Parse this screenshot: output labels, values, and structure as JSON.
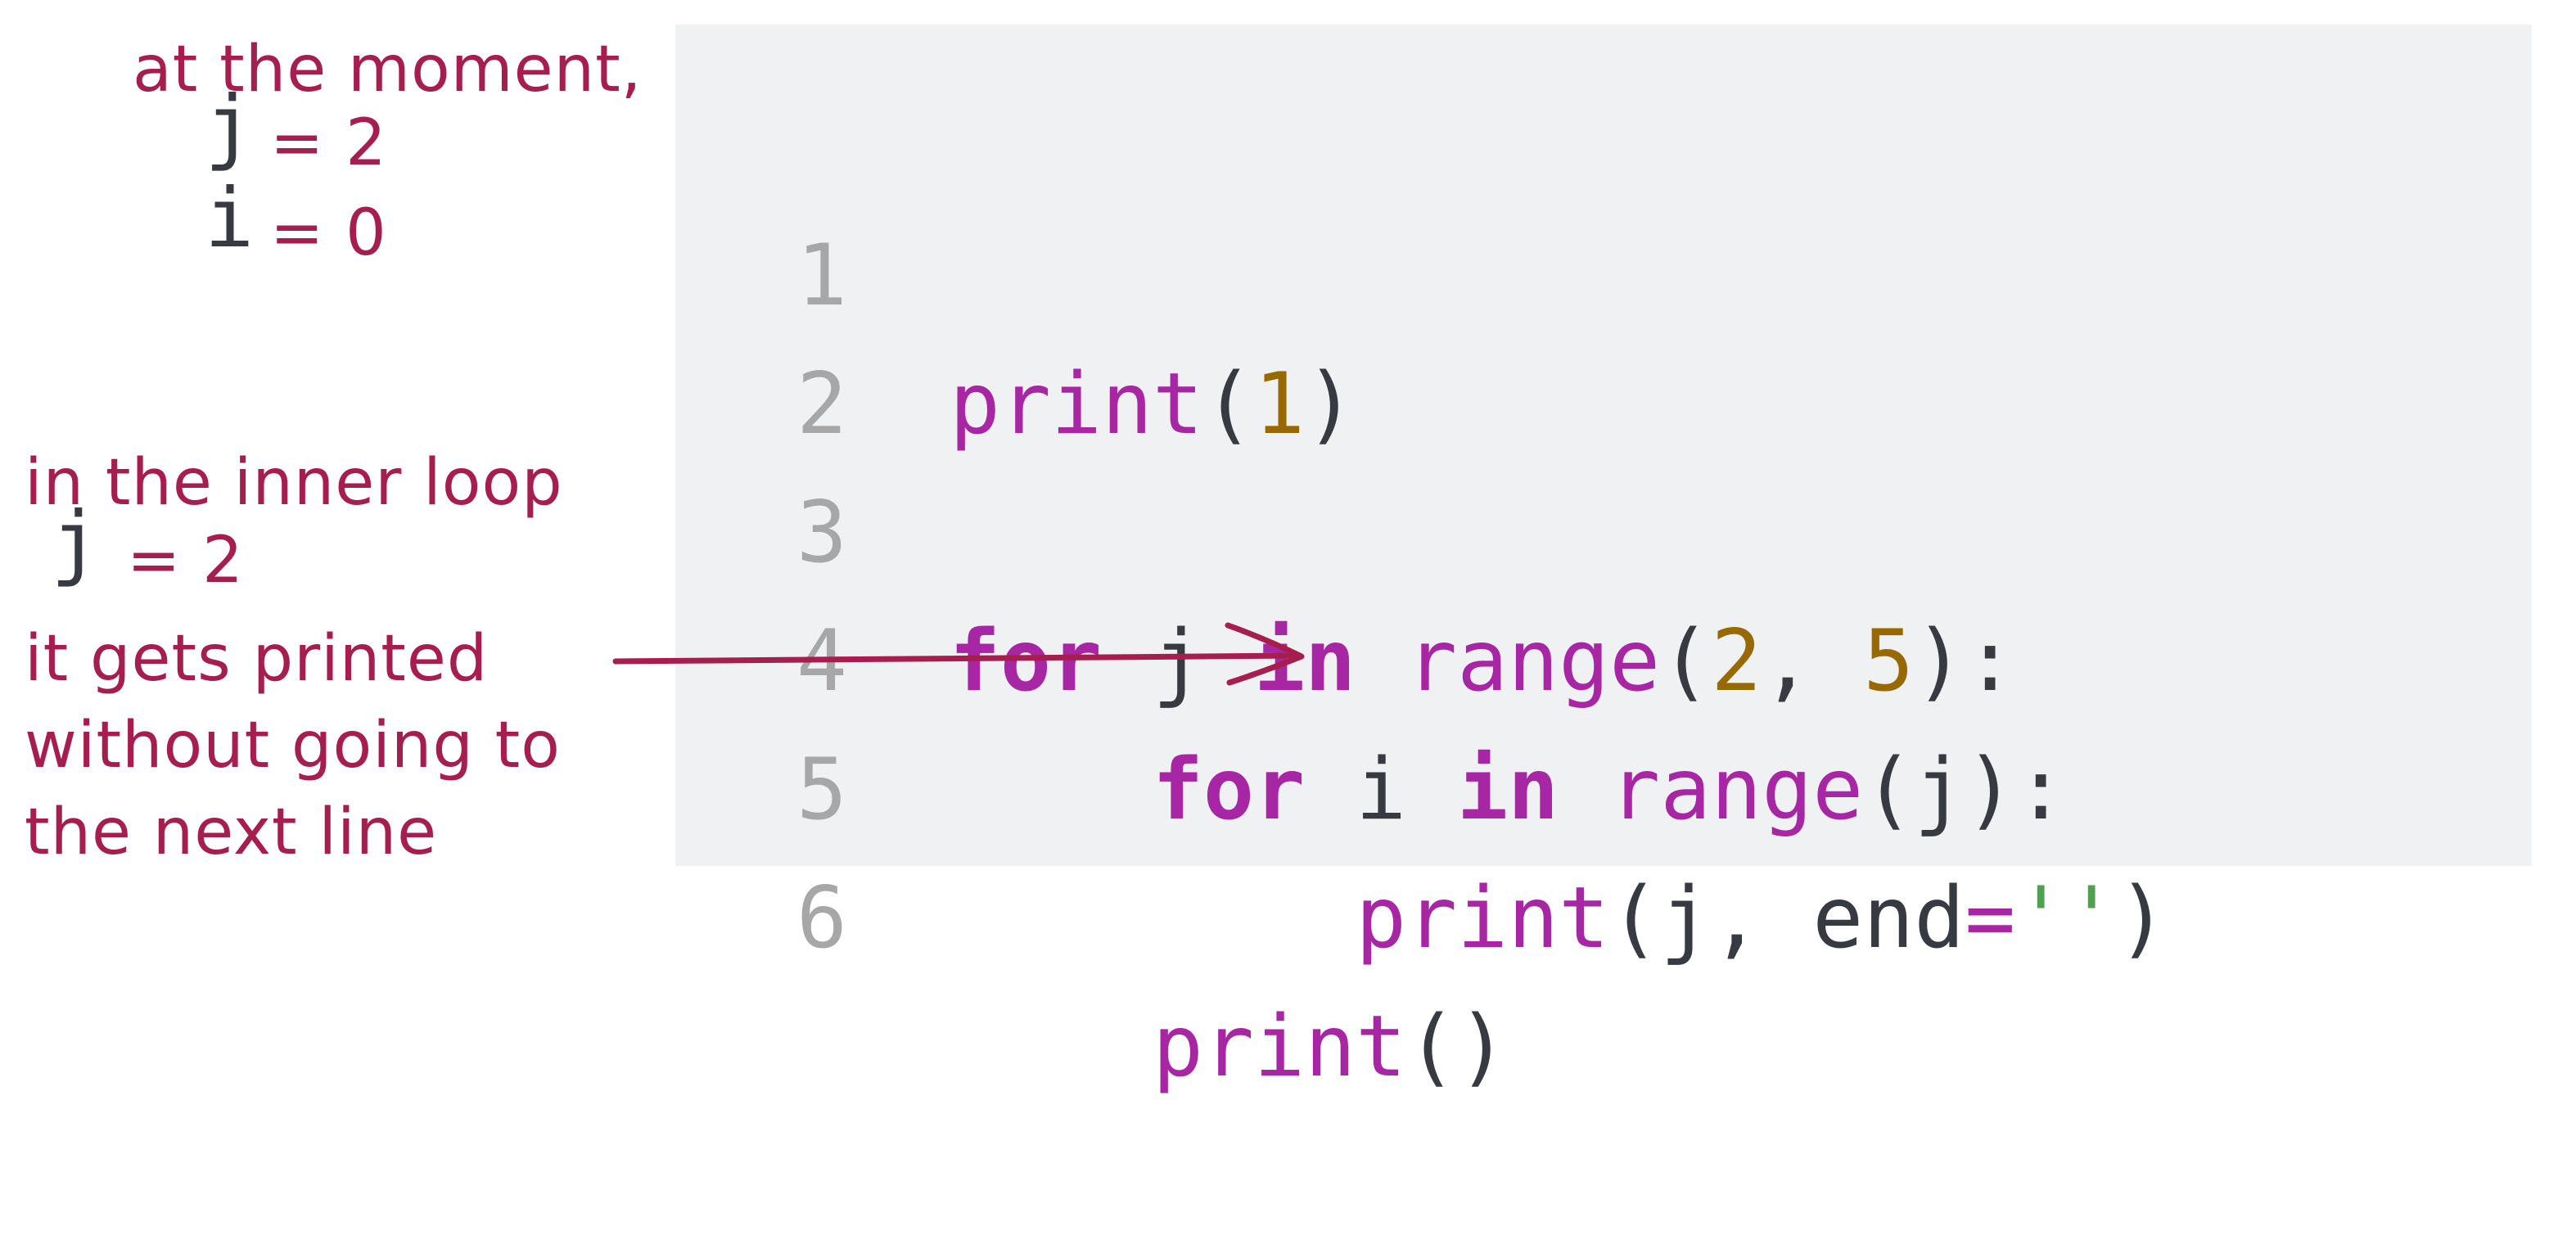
{
  "code": {
    "lines": [
      {
        "number": "1",
        "tokens": [
          {
            "t": "print",
            "c": "fn"
          },
          {
            "t": "(",
            "c": "plain"
          },
          {
            "t": "1",
            "c": "num"
          },
          {
            "t": ")",
            "c": "plain"
          }
        ]
      },
      {
        "number": "2",
        "tokens": []
      },
      {
        "number": "3",
        "tokens": [
          {
            "t": "for",
            "c": "kw"
          },
          {
            "t": " j ",
            "c": "plain"
          },
          {
            "t": "in",
            "c": "kw"
          },
          {
            "t": " ",
            "c": "plain"
          },
          {
            "t": "range",
            "c": "fn"
          },
          {
            "t": "(",
            "c": "plain"
          },
          {
            "t": "2",
            "c": "num"
          },
          {
            "t": ", ",
            "c": "plain"
          },
          {
            "t": "5",
            "c": "num"
          },
          {
            "t": "):",
            "c": "plain"
          }
        ]
      },
      {
        "number": "4",
        "tokens": [
          {
            "t": "    ",
            "c": "plain"
          },
          {
            "t": "for",
            "c": "kw"
          },
          {
            "t": " i ",
            "c": "plain"
          },
          {
            "t": "in",
            "c": "kw"
          },
          {
            "t": " ",
            "c": "plain"
          },
          {
            "t": "range",
            "c": "fn"
          },
          {
            "t": "(j):",
            "c": "plain"
          }
        ]
      },
      {
        "number": "5",
        "tokens": [
          {
            "t": "        ",
            "c": "plain"
          },
          {
            "t": "print",
            "c": "fn"
          },
          {
            "t": "(j, end",
            "c": "plain"
          },
          {
            "t": "=",
            "c": "op"
          },
          {
            "t": "''",
            "c": "str"
          },
          {
            "t": ")",
            "c": "plain"
          }
        ]
      },
      {
        "number": "6",
        "tokens": [
          {
            "t": "    ",
            "c": "plain"
          },
          {
            "t": "print",
            "c": "fn"
          },
          {
            "t": "()",
            "c": "plain"
          }
        ]
      }
    ]
  },
  "annotations": {
    "top": {
      "heading": "at the moment,",
      "j_var": "j",
      "j_eq": "= 2",
      "i_var": "i",
      "i_eq": "= 0"
    },
    "bottom": {
      "line1": "in the inner loop",
      "j_var": "j",
      "j_eq": "= 2",
      "line3": "it gets printed",
      "line4": "without going to",
      "line5": "the next line"
    },
    "arrow_target_line": 5
  },
  "colors": {
    "annotation": "#a61e4d",
    "keyword": "#a626a4",
    "number": "#986801",
    "string": "#50a14f",
    "text": "#383a42",
    "line_number": "#a7a7a7",
    "panel_bg": "#f0f1f3"
  }
}
